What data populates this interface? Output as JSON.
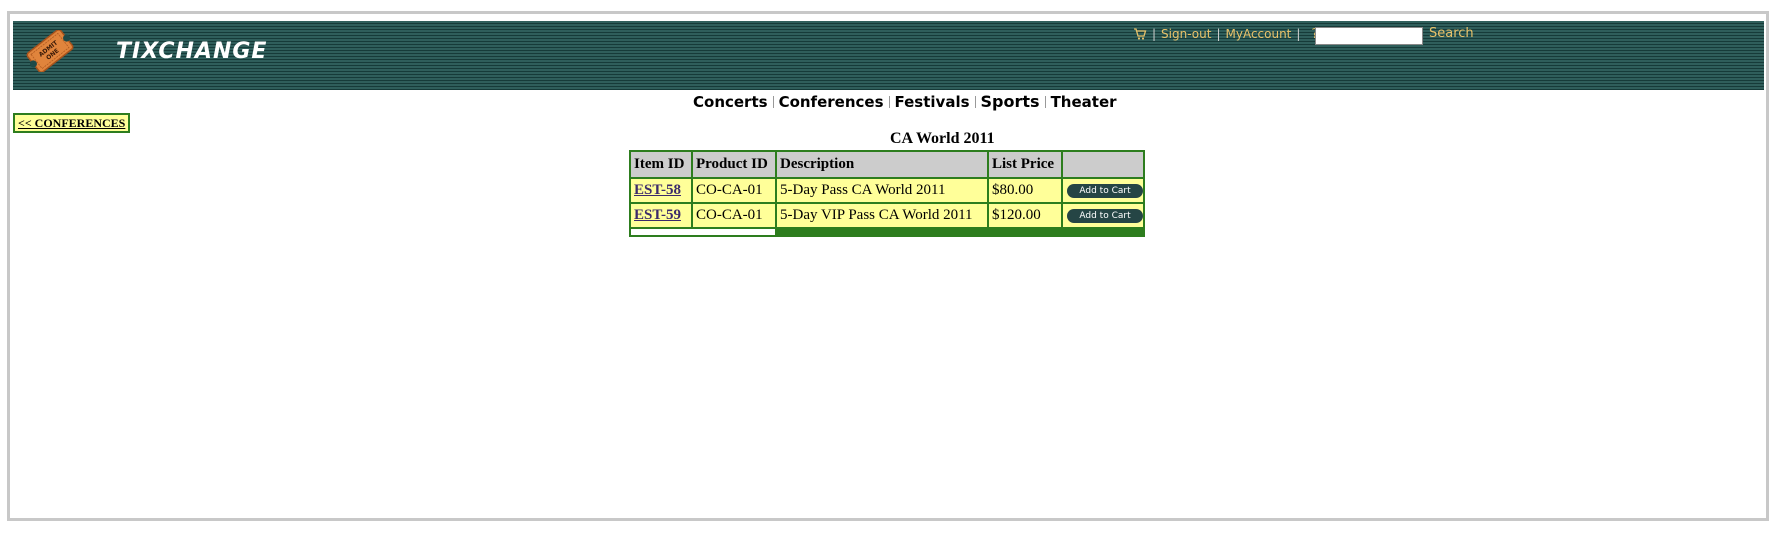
{
  "header": {
    "brand": "TIXCHANGE",
    "logo_text": "ADMIT ONE",
    "sign_out": "Sign-out",
    "my_account": "MyAccount",
    "help": "?",
    "search_value": "",
    "search_label": "Search"
  },
  "categories": [
    "Concerts",
    "Conferences",
    "Festivals",
    "Sports",
    "Theater"
  ],
  "back_link": "<< CONFERENCES",
  "page_title": "CA World 2011",
  "table": {
    "headers": [
      "Item ID",
      "Product ID",
      "Description",
      "List Price",
      ""
    ],
    "rows": [
      {
        "item_id": "EST-58",
        "product_id": "CO-CA-01",
        "description": "5-Day Pass CA World 2011",
        "price": "$80.00",
        "action": "Add to Cart"
      },
      {
        "item_id": "EST-59",
        "product_id": "CO-CA-01",
        "description": "5-Day VIP Pass CA World 2011",
        "price": "$120.00",
        "action": "Add to Cart"
      }
    ]
  },
  "colors": {
    "header_bg": "#1e4a48",
    "link_gold": "#e8c26a",
    "table_border": "#2d7d1e",
    "row_bg": "#ffff99",
    "header_cell_bg": "#cccccc"
  }
}
